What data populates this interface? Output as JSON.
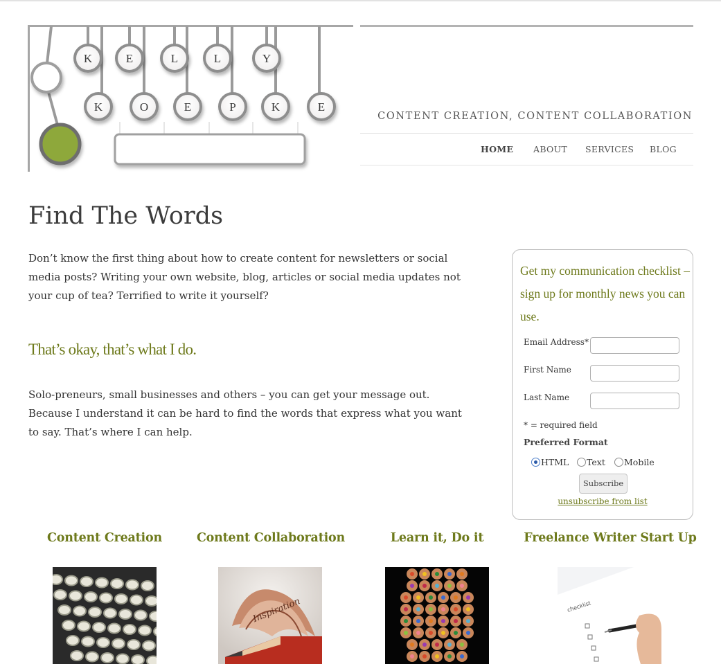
{
  "site": {
    "logo_letters_row1": [
      "K",
      "E",
      "L",
      "L",
      "Y"
    ],
    "logo_letters_row2": [
      "K",
      "O",
      "E",
      "P",
      "K",
      "E"
    ],
    "tagline": "CONTENT CREATION, CONTENT COLLABORATION"
  },
  "nav": {
    "items": [
      {
        "label": "HOME",
        "active": true
      },
      {
        "label": "ABOUT",
        "active": false
      },
      {
        "label": "SERVICES",
        "active": false
      },
      {
        "label": "BLOG",
        "active": false
      }
    ]
  },
  "main": {
    "title": "Find The Words",
    "intro": "Don’t know the first thing about how to create content for newsletters or social media posts? Writing your own website, blog, articles or social media updates not your cup of tea? Terrified to write it yourself?",
    "subheading": "That’s okay, that’s what I do.",
    "body": "Solo-preneurs, small businesses and others  – you can get your message out. Because I understand it can be hard to find the words that express what you want to say. That’s where I can help."
  },
  "signup": {
    "title": "Get my communication checklist – sign up for monthly news you can use.",
    "email_label": "Email Address*",
    "first_name_label": "First Name",
    "last_name_label": "Last Name",
    "email_value": "",
    "first_name_value": "",
    "last_name_value": "",
    "required_note": "* = required field",
    "format_label": "Preferred Format",
    "formats": [
      {
        "label": "HTML",
        "selected": true
      },
      {
        "label": "Text",
        "selected": false
      },
      {
        "label": "Mobile",
        "selected": false
      }
    ],
    "subscribe_label": "Subscribe",
    "unsubscribe_label": "unsubscribe from list"
  },
  "features": [
    {
      "title": "Content Creation",
      "image": "typewriter-keys-image"
    },
    {
      "title": "Content Collaboration",
      "image": "pencil-shavings-image"
    },
    {
      "title": "Learn it, Do it",
      "image": "colored-pencils-image"
    },
    {
      "title": "Freelance Writer Start Up",
      "image": "checklist-image"
    }
  ],
  "colors": {
    "accent_green": "#6e7a1c",
    "logo_green": "#8ea83a",
    "text": "#333333"
  }
}
